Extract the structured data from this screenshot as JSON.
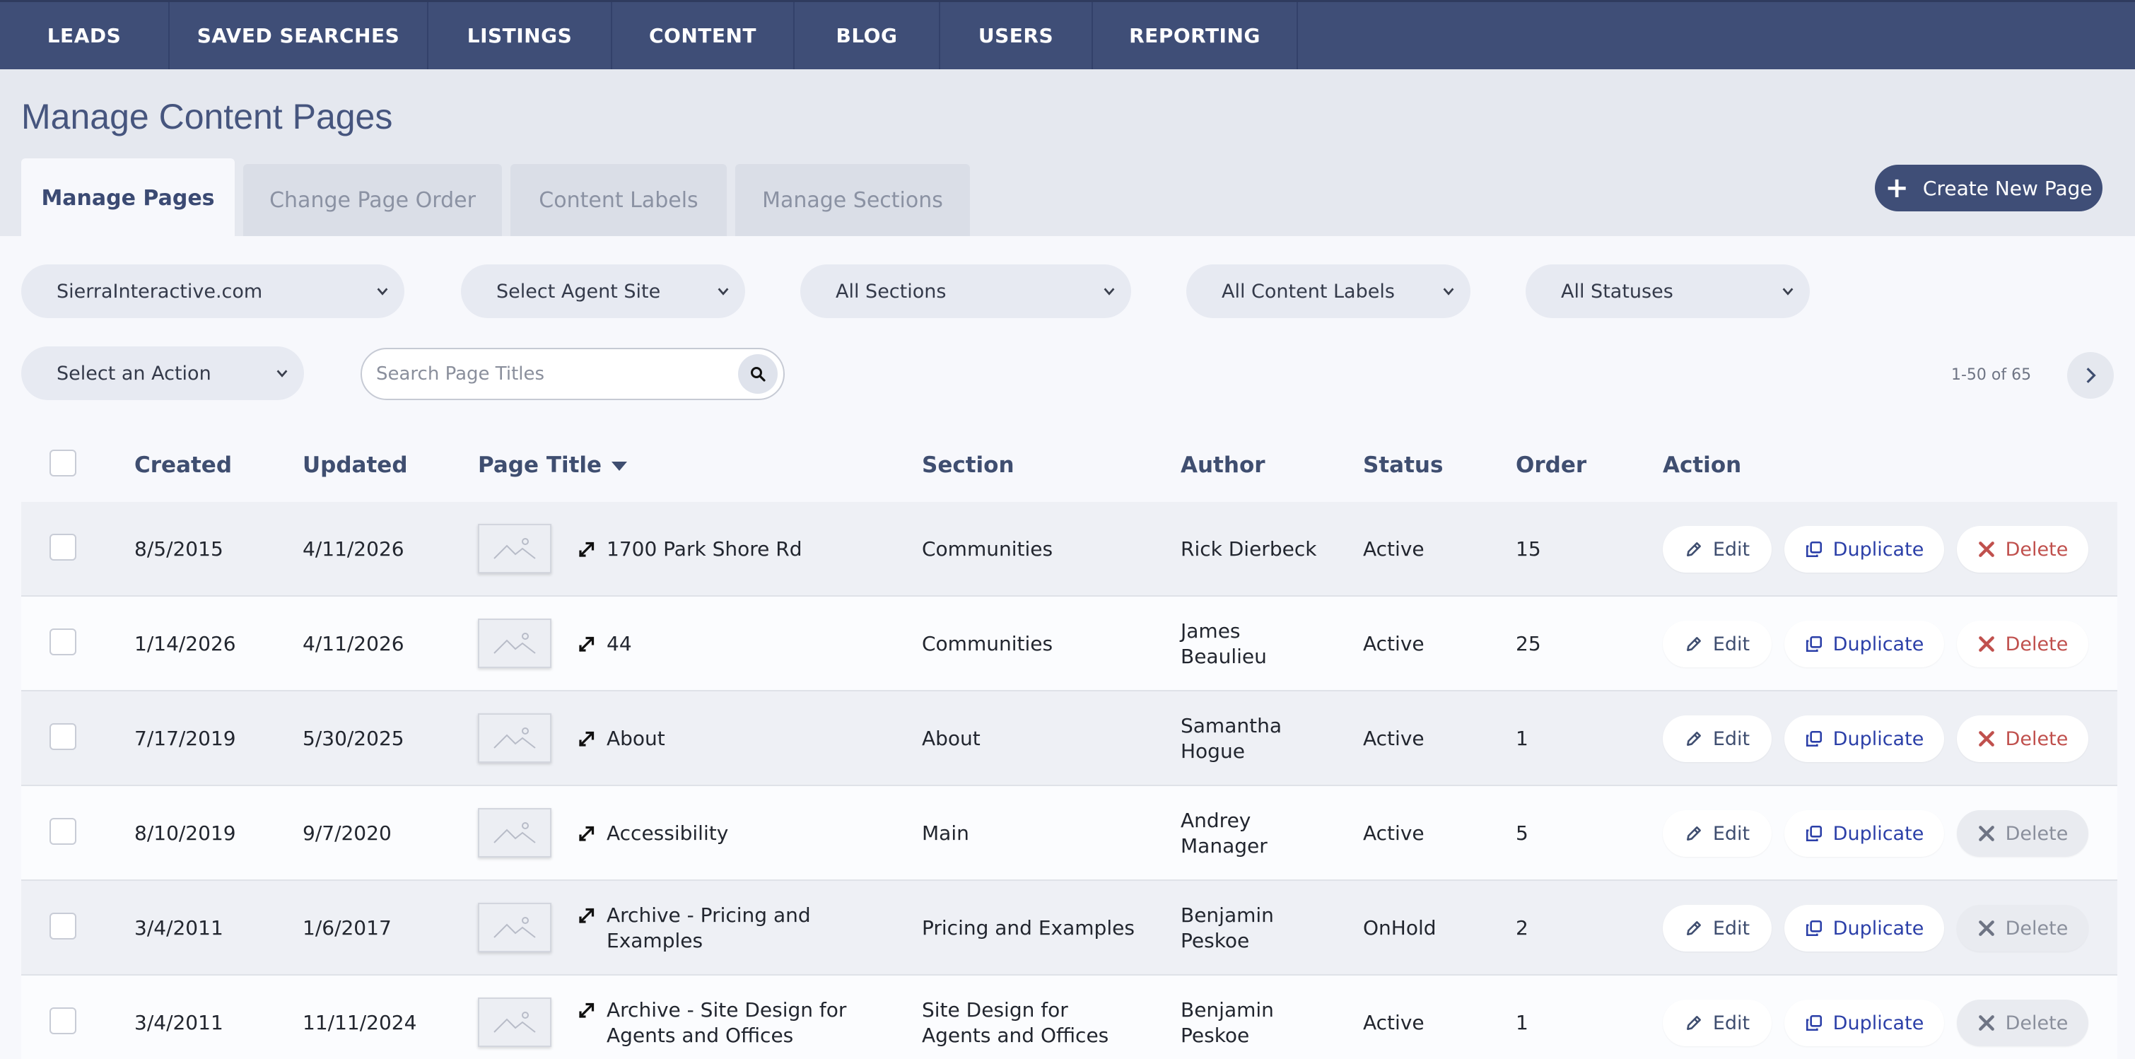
{
  "nav": {
    "items": [
      {
        "label": "LEADS"
      },
      {
        "label": "SAVED SEARCHES"
      },
      {
        "label": "LISTINGS"
      },
      {
        "label": "CONTENT"
      },
      {
        "label": "BLOG"
      },
      {
        "label": "USERS"
      },
      {
        "label": "REPORTING"
      }
    ]
  },
  "page": {
    "title": "Manage Content Pages",
    "create_button": "Create New Page"
  },
  "tabs": [
    {
      "label": "Manage Pages",
      "active": true
    },
    {
      "label": "Change Page Order",
      "active": false
    },
    {
      "label": "Content Labels",
      "active": false
    },
    {
      "label": "Manage Sections",
      "active": false
    }
  ],
  "filters": {
    "site": "SierraInteractive.com",
    "agent_site": "Select Agent Site",
    "sections": "All Sections",
    "content_labels": "All Content Labels",
    "statuses": "All Statuses",
    "action": "Select an Action"
  },
  "search": {
    "placeholder": "Search Page Titles",
    "value": ""
  },
  "pagination": {
    "range_text": "1-50 of 65"
  },
  "table": {
    "headers": {
      "created": "Created",
      "updated": "Updated",
      "page_title": "Page Title",
      "section": "Section",
      "author": "Author",
      "status": "Status",
      "order": "Order",
      "action": "Action"
    },
    "actions": {
      "edit": "Edit",
      "duplicate": "Duplicate",
      "delete": "Delete"
    },
    "rows": [
      {
        "created": "8/5/2015",
        "updated": "4/11/2026",
        "title_line1": "1700 Park Shore Rd",
        "title_line2": "",
        "section_line1": "Communities",
        "section_line2": "",
        "author_line1": "Rick Dierbeck",
        "author_line2": "",
        "status": "Active",
        "order": "15",
        "delete_enabled": true
      },
      {
        "created": "1/14/2026",
        "updated": "4/11/2026",
        "title_line1": "44",
        "title_line2": "",
        "section_line1": "Communities",
        "section_line2": "",
        "author_line1": "James",
        "author_line2": "Beaulieu",
        "status": "Active",
        "order": "25",
        "delete_enabled": true
      },
      {
        "created": "7/17/2019",
        "updated": "5/30/2025",
        "title_line1": "About",
        "title_line2": "",
        "section_line1": "About",
        "section_line2": "",
        "author_line1": "Samantha",
        "author_line2": "Hogue",
        "status": "Active",
        "order": "1",
        "delete_enabled": true
      },
      {
        "created": "8/10/2019",
        "updated": "9/7/2020",
        "title_line1": "Accessibility",
        "title_line2": "",
        "section_line1": "Main",
        "section_line2": "",
        "author_line1": "Andrey",
        "author_line2": "Manager",
        "status": "Active",
        "order": "5",
        "delete_enabled": false
      },
      {
        "created": "3/4/2011",
        "updated": "1/6/2017",
        "title_line1": "Archive - Pricing and",
        "title_line2": "Examples",
        "section_line1": "Pricing and Examples",
        "section_line2": "",
        "author_line1": "Benjamin",
        "author_line2": "Peskoe",
        "status": "OnHold",
        "order": "2",
        "delete_enabled": false
      },
      {
        "created": "3/4/2011",
        "updated": "11/11/2024",
        "title_line1": "Archive - Site Design for",
        "title_line2": "Agents and Offices",
        "section_line1": "Site Design for",
        "section_line2": "Agents and Offices",
        "author_line1": "Benjamin",
        "author_line2": "Peskoe",
        "status": "Active",
        "order": "1",
        "delete_enabled": false
      }
    ]
  }
}
